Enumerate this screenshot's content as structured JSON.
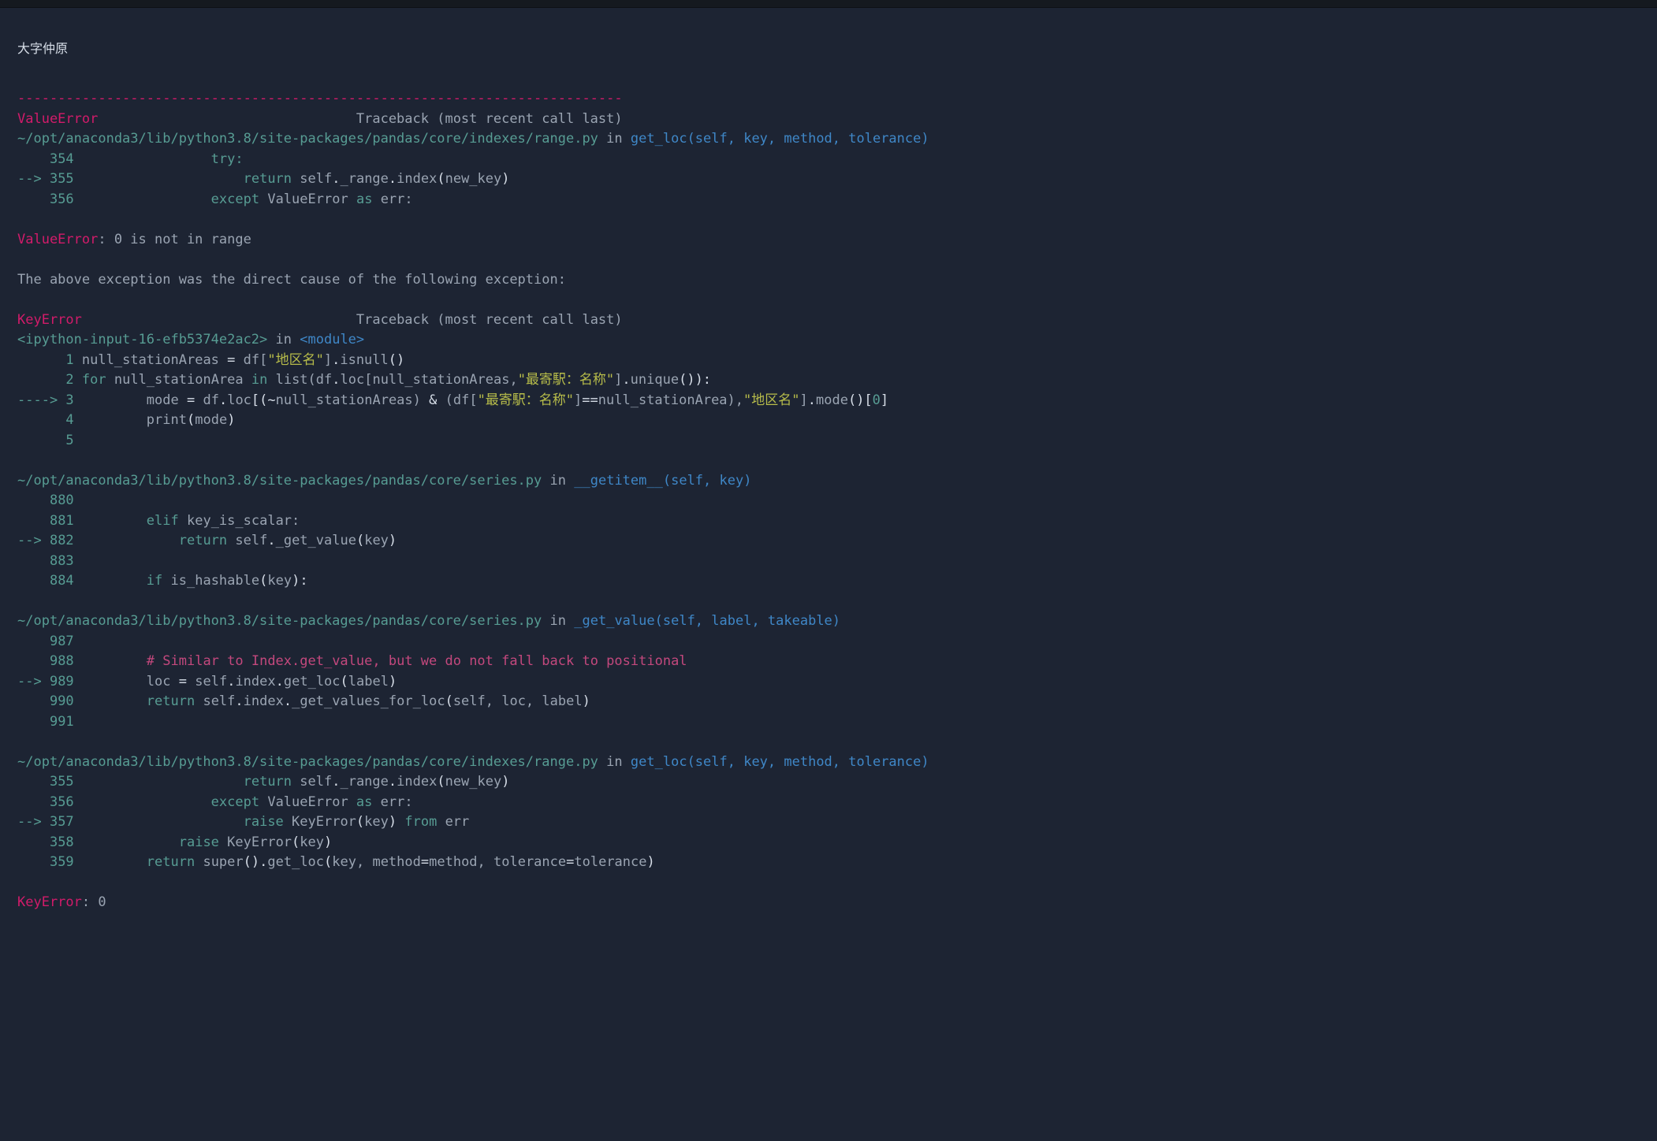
{
  "title": "大字仲原",
  "rule": "---------------------------------------------------------------------------",
  "tb_label": "Traceback (most recent call last)",
  "err1_name": "ValueError",
  "frame1": {
    "path": "~/opt/anaconda3/lib/python3.8/site-packages/pandas/core/indexes/range.py",
    "in": "in",
    "func": "get_loc",
    "sig": "(self, key, method, tolerance)",
    "l354_no": "354",
    "l354_code": "try:",
    "arrow355": "--> ",
    "l355_no": "355",
    "l355_return": "return",
    "l355_self": "self",
    "l355_dot1": ".",
    "l355_range": "_range",
    "l355_dot2": ".",
    "l355_index": "index",
    "l355_p1": "(",
    "l355_arg": "new_key",
    "l355_p2": ")",
    "l356_no": "356",
    "l356_except": "except",
    "l356_ve": "ValueError",
    "l356_as": "as",
    "l356_err": "err:"
  },
  "ve_msg_name": "ValueError",
  "ve_msg_body": ": 0 is not in range",
  "chain_msg": "The above exception was the direct cause of the following exception:",
  "err2_name": "KeyError",
  "frame2": {
    "ipy": "<ipython-input-16-efb5374e2ac2>",
    "in": "in",
    "module": "<module>",
    "l1_no": "1",
    "l1_a": "null_stationAreas ",
    "l1_eq": "=",
    "l1_b": " df[",
    "l1_str": "\"地区名\"",
    "l1_c": "]",
    "l1_dot": ".",
    "l1_isnull": "isnull",
    "l1_paren": "()",
    "l2_no": "2",
    "l2_for": "for",
    "l2_a": " null_stationArea ",
    "l2_in": "in",
    "l2_b": " list(df",
    "l2_dot1": ".",
    "l2_loc": "loc",
    "l2_c": "[null_stationAreas,",
    "l2_str": "\"最寄駅：名称\"",
    "l2_d": "]",
    "l2_dot2": ".",
    "l2_unique": "unique",
    "l2_e": "()):",
    "arrow3": "----> ",
    "l3_no": "3",
    "l3_a": "mode ",
    "l3_eq": "=",
    "l3_b": " df",
    "l3_dot1": ".",
    "l3_loc": "loc",
    "l3_c": "[(",
    "l3_tilde": "~",
    "l3_d": "null_stationAreas) ",
    "l3_amp": "&",
    "l3_e": " (df[",
    "l3_str1": "\"最寄駅：名称\"",
    "l3_f": "]",
    "l3_eqeq": "==",
    "l3_g": "null_stationArea),",
    "l3_str2": "\"地区名\"",
    "l3_h": "]",
    "l3_dot2": ".",
    "l3_mode": "mode",
    "l3_i": "()[",
    "l3_zero": "0",
    "l3_j": "]",
    "l4_no": "4",
    "l4_print": "print",
    "l4_p1": "(",
    "l4_arg": "mode",
    "l4_p2": ")",
    "l5_no": "5"
  },
  "frame3": {
    "path": "~/opt/anaconda3/lib/python3.8/site-packages/pandas/core/series.py",
    "in": "in",
    "func": "__getitem__",
    "sig": "(self, key)",
    "l880_no": "880",
    "l881_no": "881",
    "l881_elif": "elif",
    "l881_body": " key_is_scalar:",
    "arrow882": "--> ",
    "l882_no": "882",
    "l882_return": "return",
    "l882_self": " self",
    "l882_dot": ".",
    "l882_fn": "_get_value",
    "l882_p1": "(",
    "l882_arg": "key",
    "l882_p2": ")",
    "l883_no": "883",
    "l884_no": "884",
    "l884_if": "if",
    "l884_fn": " is_hashable",
    "l884_p1": "(",
    "l884_arg": "key",
    "l884_p2": "):"
  },
  "frame4": {
    "path": "~/opt/anaconda3/lib/python3.8/site-packages/pandas/core/series.py",
    "in": "in",
    "func": "_get_value",
    "sig": "(self, label, takeable)",
    "l987_no": "987",
    "l988_no": "988",
    "l988_comment": "# Similar to Index.get_value, but we do not fall back to positional",
    "arrow989": "--> ",
    "l989_no": "989",
    "l989_a": "loc ",
    "l989_eq": "=",
    "l989_b": " self",
    "l989_dot1": ".",
    "l989_idx": "index",
    "l989_dot2": ".",
    "l989_fn": "get_loc",
    "l989_p1": "(",
    "l989_arg": "label",
    "l989_p2": ")",
    "l990_no": "990",
    "l990_return": "return",
    "l990_self": " self",
    "l990_dot1": ".",
    "l990_idx": "index",
    "l990_dot2": ".",
    "l990_fn": "_get_values_for_loc",
    "l990_p1": "(",
    "l990_args": "self, loc, label",
    "l990_p2": ")",
    "l991_no": "991"
  },
  "frame5": {
    "path": "~/opt/anaconda3/lib/python3.8/site-packages/pandas/core/indexes/range.py",
    "in": "in",
    "func": "get_loc",
    "sig": "(self, key, method, tolerance)",
    "l355_no": "355",
    "l355_return": "return",
    "l355_self": " self",
    "l355_dot1": ".",
    "l355_range": "_range",
    "l355_dot2": ".",
    "l355_index": "index",
    "l355_p1": "(",
    "l355_arg": "new_key",
    "l355_p2": ")",
    "l356_no": "356",
    "l356_except": "except",
    "l356_ve": " ValueError ",
    "l356_as": "as",
    "l356_err": " err:",
    "arrow357": "--> ",
    "l357_no": "357",
    "l357_raise": "raise",
    "l357_ke": " KeyError",
    "l357_p1": "(",
    "l357_arg": "key",
    "l357_p2": ") ",
    "l357_from": "from",
    "l357_err": " err",
    "l358_no": "358",
    "l358_raise": "raise",
    "l358_ke": " KeyError",
    "l358_p1": "(",
    "l358_arg": "key",
    "l358_p2": ")",
    "l359_no": "359",
    "l359_return": "return",
    "l359_super": " super",
    "l359_p0": "()",
    "l359_dot": ".",
    "l359_fn": "get_loc",
    "l359_p1": "(",
    "l359_a1": "key, method",
    "l359_eq1": "=",
    "l359_a2": "method, tolerance",
    "l359_eq2": "=",
    "l359_a3": "tolerance",
    "l359_p2": ")"
  },
  "ke_msg_name": "KeyError",
  "ke_msg_body": ": 0"
}
